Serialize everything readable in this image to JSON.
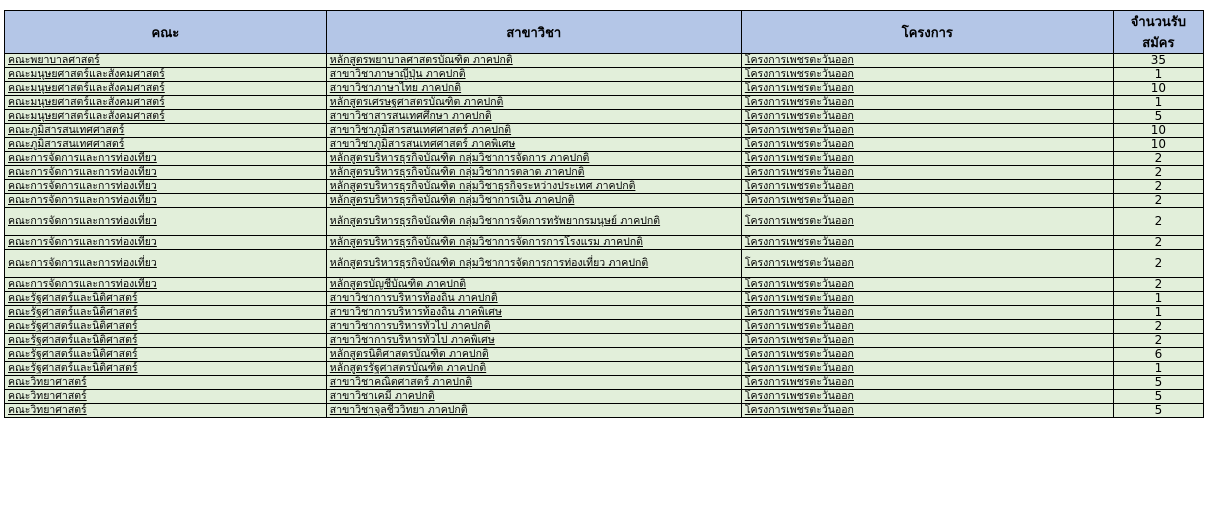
{
  "headers": [
    "คณะ",
    "สาขาวิชา",
    "โครงการ",
    "จำนวนรับสมัคร"
  ],
  "rows": [
    {
      "faculty": "คณะพยาบาลศาสตร์",
      "program": "หลักสูตรพยาบาลศาสตรบัณฑิต ภาคปกติ",
      "project": "โครงการเพชรตะวันออก",
      "count": "35"
    },
    {
      "faculty": "คณะมนุษยศาสตร์และสังคมศาสตร์",
      "program": "สาขาวิชาภาษาญี่ปุ่น ภาคปกติ",
      "project": "โครงการเพชรตะวันออก",
      "count": "1"
    },
    {
      "faculty": "คณะมนุษยศาสตร์และสังคมศาสตร์",
      "program": "สาขาวิชาภาษาไทย ภาคปกติ",
      "project": "โครงการเพชรตะวันออก",
      "count": "10"
    },
    {
      "faculty": "คณะมนุษยศาสตร์และสังคมศาสตร์",
      "program": "หลักสูตรเศรษฐศาสตรบัณฑิต ภาคปกติ",
      "project": "โครงการเพชรตะวันออก",
      "count": "1"
    },
    {
      "faculty": "คณะมนุษยศาสตร์และสังคมศาสตร์",
      "program": "สาขาวิชาสารสนเทศศึกษา ภาคปกติ",
      "project": "โครงการเพชรตะวันออก",
      "count": "5"
    },
    {
      "faculty": "คณะภูมิสารสนเทศศาสตร์",
      "program": "สาขาวิชาภูมิสารสนเทศศาสตร์ ภาคปกติ",
      "project": "โครงการเพชรตะวันออก",
      "count": "10"
    },
    {
      "faculty": "คณะภูมิสารสนเทศศาสตร์",
      "program": "สาขาวิชาภูมิสารสนเทศศาสตร์ ภาคพิเศษ",
      "project": "โครงการเพชรตะวันออก",
      "count": "10"
    },
    {
      "faculty": "คณะการจัดการและการท่องเที่ยว",
      "program": "หลักสูตรบริหารธุรกิจบัณฑิต กลุ่มวิชาการจัดการ ภาคปกติ",
      "project": "โครงการเพชรตะวันออก",
      "count": "2"
    },
    {
      "faculty": "คณะการจัดการและการท่องเที่ยว",
      "program": "หลักสูตรบริหารธุรกิจบัณฑิต กลุ่มวิชาการตลาด ภาคปกติ",
      "project": "โครงการเพชรตะวันออก",
      "count": "2"
    },
    {
      "faculty": "คณะการจัดการและการท่องเที่ยว",
      "program": "หลักสูตรบริหารธุรกิจบัณฑิต กลุ่มวิชาธุรกิจระหว่างประเทศ ภาคปกติ",
      "project": "โครงการเพชรตะวันออก",
      "count": "2"
    },
    {
      "faculty": "คณะการจัดการและการท่องเที่ยว",
      "program": "หลักสูตรบริหารธุรกิจบัณฑิต กลุ่มวิชาการเงิน ภาคปกติ",
      "project": "โครงการเพชรตะวันออก",
      "count": "2"
    },
    {
      "faculty": "คณะการจัดการและการท่องเที่ยว",
      "program": "หลักสูตรบริหารธุรกิจบัณฑิต กลุ่มวิชาการจัดการทรัพยากรมนุษย์ ภาคปกติ",
      "project": "โครงการเพชรตะวันออก",
      "count": "2",
      "tall": true
    },
    {
      "faculty": "คณะการจัดการและการท่องเที่ยว",
      "program": "หลักสูตรบริหารธุรกิจบัณฑิต กลุ่มวิชาการจัดการการโรงแรม ภาคปกติ",
      "project": "โครงการเพชรตะวันออก",
      "count": "2"
    },
    {
      "faculty": "คณะการจัดการและการท่องเที่ยว",
      "program": "หลักสูตรบริหารธุรกิจบัณฑิต กลุ่มวิชาการจัดการการท่องเที่ยว ภาคปกติ",
      "project": "โครงการเพชรตะวันออก",
      "count": "2",
      "tall": true
    },
    {
      "faculty": "คณะการจัดการและการท่องเที่ยว",
      "program": "หลักสูตรบัญชีบัณฑิต ภาคปกติ",
      "project": "โครงการเพชรตะวันออก",
      "count": "2"
    },
    {
      "faculty": "คณะรัฐศาสตร์และนิติศาสตร์",
      "program": "สาขาวิชาการบริหารท้องถิ่น ภาคปกติ",
      "project": "โครงการเพชรตะวันออก",
      "count": "1"
    },
    {
      "faculty": "คณะรัฐศาสตร์และนิติศาสตร์",
      "program": "สาขาวิชาการบริหารท้องถิ่น ภาคพิเศษ",
      "project": "โครงการเพชรตะวันออก",
      "count": "1"
    },
    {
      "faculty": "คณะรัฐศาสตร์และนิติศาสตร์",
      "program": "สาขาวิชาการบริหารทั่วไป ภาคปกติ",
      "project": "โครงการเพชรตะวันออก",
      "count": "2"
    },
    {
      "faculty": "คณะรัฐศาสตร์และนิติศาสตร์",
      "program": "สาขาวิชาการบริหารทั่วไป ภาคพิเศษ",
      "project": "โครงการเพชรตะวันออก",
      "count": "2"
    },
    {
      "faculty": "คณะรัฐศาสตร์และนิติศาสตร์",
      "program": "หลักสูตรนิติศาสตรบัณฑิต ภาคปกติ",
      "project": "โครงการเพชรตะวันออก",
      "count": "6"
    },
    {
      "faculty": "คณะรัฐศาสตร์และนิติศาสตร์",
      "program": "หลักสูตรรัฐศาสตรบัณฑิต ภาคปกติ",
      "project": "โครงการเพชรตะวันออก",
      "count": "1"
    },
    {
      "faculty": "คณะวิทยาศาสตร์",
      "program": "สาขาวิชาคณิตศาสตร์ ภาคปกติ",
      "project": "โครงการเพชรตะวันออก",
      "count": "5"
    },
    {
      "faculty": "คณะวิทยาศาสตร์",
      "program": "สาขาวิชาเคมี ภาคปกติ",
      "project": "โครงการเพชรตะวันออก",
      "count": "5"
    },
    {
      "faculty": "คณะวิทยาศาสตร์",
      "program": "สาขาวิชาจุลชีววิทยา ภาคปกติ",
      "project": "โครงการเพชรตะวันออก",
      "count": "5"
    }
  ]
}
